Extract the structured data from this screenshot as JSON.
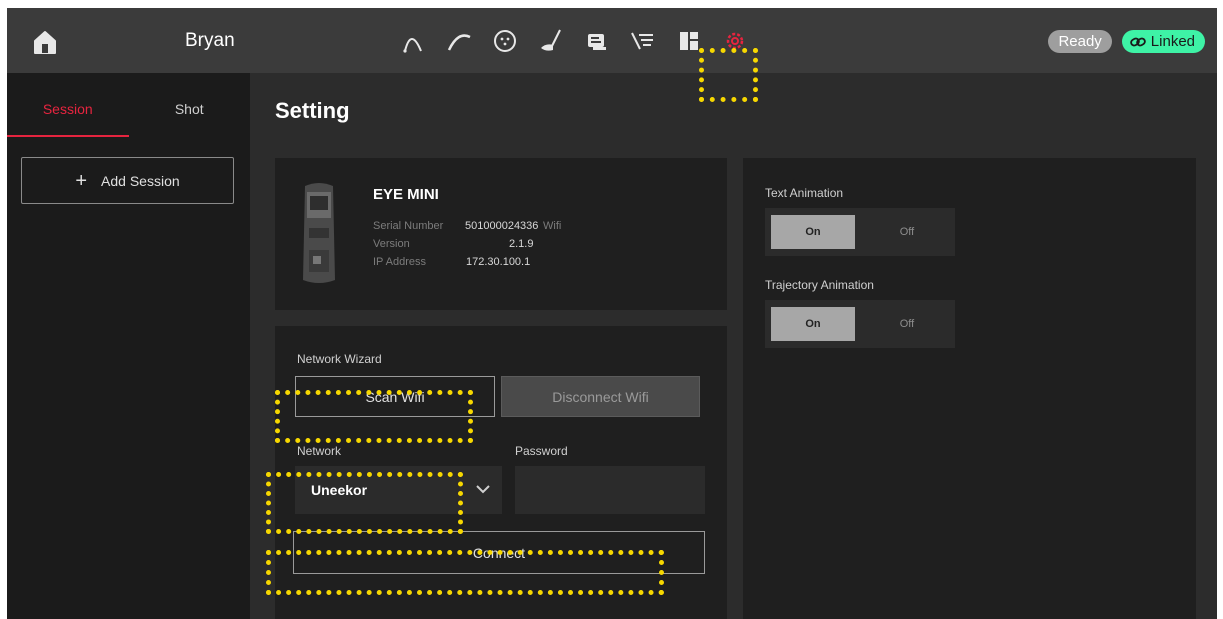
{
  "header": {
    "user_name": "Bryan",
    "nav_icons": [
      "trajectory-high-icon",
      "trajectory-low-icon",
      "ball-icon",
      "club-icon",
      "shot-list-icon",
      "filter-list-icon",
      "dashboard-icon",
      "settings-icon"
    ],
    "status_ready": "Ready",
    "status_linked": "Linked"
  },
  "sidebar": {
    "tabs": [
      {
        "label": "Session",
        "active": true
      },
      {
        "label": "Shot",
        "active": false
      }
    ],
    "add_session_label": "Add Session"
  },
  "main": {
    "title": "Setting",
    "device": {
      "name": "EYE MINI",
      "serial_label": "Serial Number",
      "serial_value": "501000024336",
      "serial_extra": "Wifi",
      "version_label": "Version",
      "version_value": "2.1.9",
      "ip_label": "IP Address",
      "ip_value": "172.30.100.1"
    },
    "network": {
      "wizard_label": "Network Wizard",
      "scan_button": "Scan Wifi",
      "disconnect_button": "Disconnect Wifi",
      "network_label": "Network",
      "network_value": "Uneekor",
      "password_label": "Password",
      "password_value": "",
      "connect_button": "Connect"
    },
    "animation": {
      "text_label": "Text Animation",
      "text_on": "On",
      "text_off": "Off",
      "trajectory_label": "Trajectory Animation",
      "trajectory_on": "On",
      "trajectory_off": "Off"
    }
  },
  "colors": {
    "accent_red": "#e6243f",
    "linked_green": "#3ef3a6",
    "annotation_yellow": "#f7d800"
  }
}
